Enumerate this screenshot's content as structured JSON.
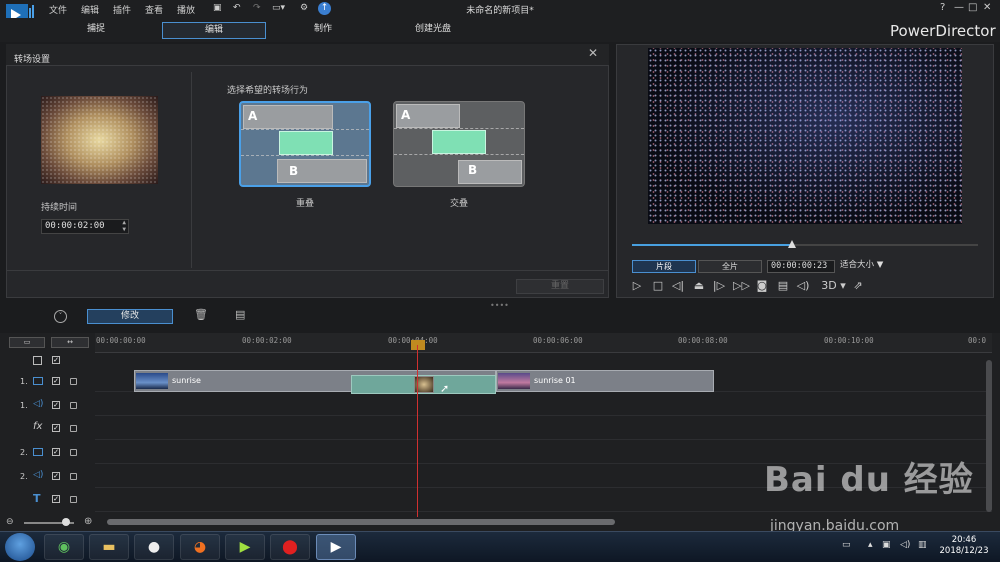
{
  "window": {
    "title": "未命名的新项目*",
    "brand": "PowerDirector",
    "controls": [
      "?",
      "—",
      "□",
      "✕"
    ]
  },
  "menu": {
    "items": [
      "文件",
      "编辑",
      "插件",
      "查看",
      "播放"
    ]
  },
  "modes": {
    "tabs": [
      "捕捉",
      "编辑",
      "制作",
      "创建光盘"
    ],
    "active": "编辑"
  },
  "transition_panel": {
    "title": "转场设置",
    "duration_label": "持续时间",
    "duration_value": "00:00:02:00",
    "behavior_label": "选择希望的转场行为",
    "options": [
      {
        "label": "重叠",
        "a": "A",
        "b": "B",
        "selected": true
      },
      {
        "label": "交叠",
        "a": "A",
        "b": "B",
        "selected": false
      }
    ],
    "reset_label": "重置"
  },
  "preview": {
    "tab_clip": "片段",
    "tab_movie": "全片",
    "timecode": "00:00:00:23",
    "fit_label": "适合大小",
    "three_d": "3D",
    "scrub_progress": 0.46
  },
  "edit_toolbar": {
    "modify_label": "修改"
  },
  "timeline": {
    "ticks": [
      "00:00:00:00",
      "00:00:02:00",
      "00:00:04:00",
      "00:00:06:00",
      "00:00:08:00",
      "00:00:10:00",
      "00:0"
    ],
    "tracks": [
      {
        "num": "1.",
        "type": "video"
      },
      {
        "num": "1.",
        "type": "audio"
      },
      {
        "num": "",
        "type": "fx",
        "icon": "fx"
      },
      {
        "num": "2.",
        "type": "video"
      },
      {
        "num": "2.",
        "type": "audio"
      },
      {
        "num": "",
        "type": "title",
        "icon": "T"
      }
    ],
    "clips": [
      {
        "label": "sunrise"
      },
      {
        "label": "sunrise 01"
      }
    ]
  },
  "taskbar": {
    "time": "20:46",
    "date": "2018/12/23"
  },
  "watermark": {
    "main": "Bai du 经验",
    "sub": "jingyan.baidu.com"
  }
}
